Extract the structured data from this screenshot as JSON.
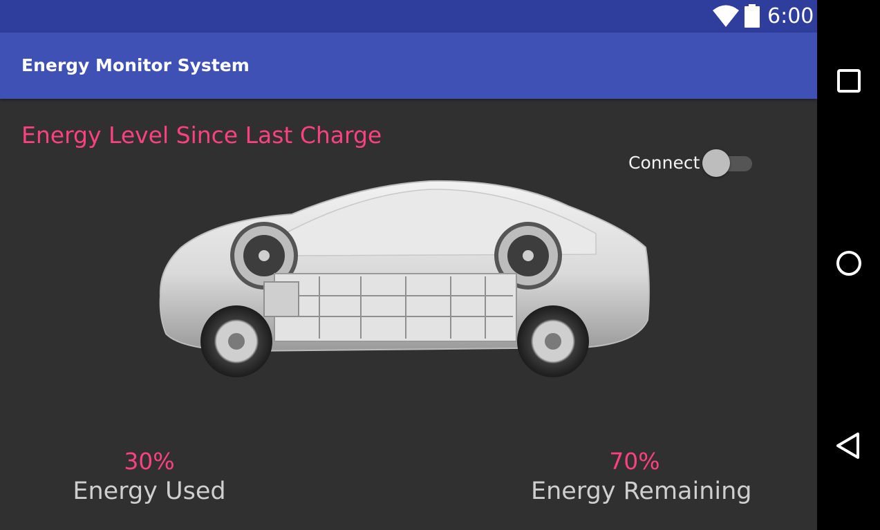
{
  "status_bar": {
    "time": "6:00",
    "icons": [
      "wifi-icon",
      "battery-icon"
    ]
  },
  "app_bar": {
    "title": "Energy Monitor System",
    "color": "#3f51b5"
  },
  "main": {
    "section_title": "Energy Level Since Last Charge",
    "connect_label": "Connect",
    "connect_switch_on": false,
    "car_image": "electric-car-battery-cutaway",
    "stats": [
      {
        "value": "30%",
        "label": "Energy Used"
      },
      {
        "value": "70%",
        "label": "Energy Remaining"
      }
    ]
  },
  "nav_bar": {
    "buttons": [
      "recents-icon",
      "home-icon",
      "back-icon"
    ]
  },
  "colors": {
    "accent": "#ff4081",
    "primary": "#3f51b5",
    "primary_dark": "#2f3d9d",
    "background": "#303030"
  }
}
